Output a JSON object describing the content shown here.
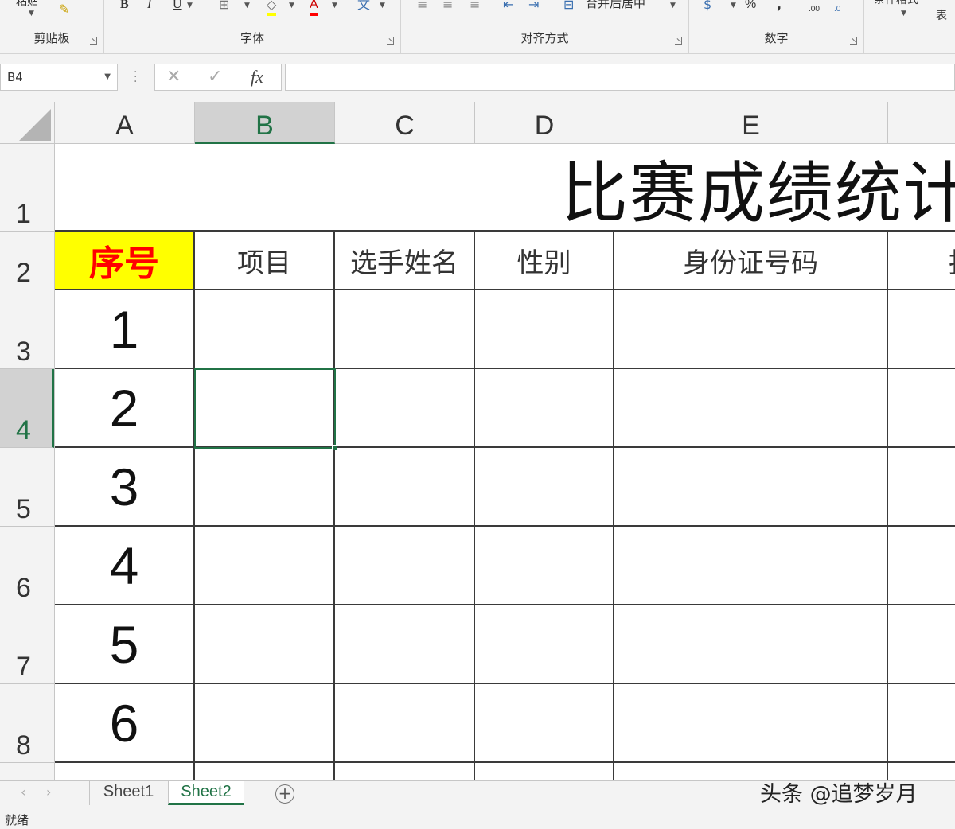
{
  "ribbon": {
    "groups": {
      "clipboard": "剪贴板",
      "font": "字体",
      "alignment": "对齐方式",
      "number": "数字"
    },
    "top_labels": {
      "paste": "粘贴",
      "merge_center": "合并后居中",
      "conditional": "条件格式",
      "table": "表"
    },
    "font_buttons": {
      "bold": "B",
      "italic": "I",
      "underline": "U",
      "font_color": "A",
      "phonetic": "文"
    },
    "number_buttons": {
      "percent": "%",
      "comma": ",",
      "inc_decimal": ".00",
      "dec_decimal": ".0"
    }
  },
  "formula_bar": {
    "name_box": "B4",
    "cancel": "✕",
    "enter": "✓",
    "fx": "fx",
    "formula": ""
  },
  "columns": [
    "A",
    "B",
    "C",
    "D",
    "E"
  ],
  "rows": [
    "1",
    "2",
    "3",
    "4",
    "5",
    "6",
    "7",
    "8"
  ],
  "sheet": {
    "title": "比赛成绩统计",
    "headers": [
      "序号",
      "项目",
      "选手姓名",
      "性别",
      "身份证号码",
      "报"
    ],
    "seq": [
      "1",
      "2",
      "3",
      "4",
      "5",
      "6"
    ],
    "active_cell": "B4",
    "colors": {
      "header_fill": "#ffff00",
      "header_text": "#ff0000",
      "accent": "#217346"
    }
  },
  "tabs": {
    "sheets": [
      "Sheet1",
      "Sheet2"
    ],
    "active": "Sheet2",
    "add": "+"
  },
  "watermark": "头条 @追梦岁月",
  "status": "就绪"
}
